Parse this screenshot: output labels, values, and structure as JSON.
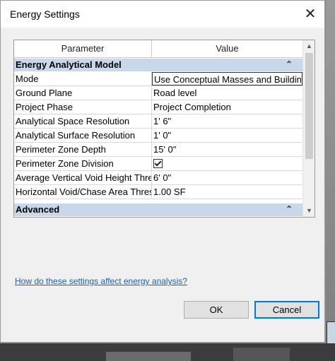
{
  "dialog": {
    "title": "Energy Settings",
    "close_glyph": "✕"
  },
  "grid": {
    "headers": {
      "parameter": "Parameter",
      "value": "Value"
    },
    "categories": [
      {
        "label": "Energy Analytical Model",
        "chevron": "⌃"
      },
      {
        "label": "Advanced",
        "chevron": "⌃"
      }
    ],
    "rows": [
      {
        "param": "Mode",
        "value": "Use Conceptual Masses and Buildin"
      },
      {
        "param": "Ground Plane",
        "value": "Road level"
      },
      {
        "param": "Project Phase",
        "value": "Project Completion"
      },
      {
        "param": "Analytical Space Resolution",
        "value": "1'  6\""
      },
      {
        "param": "Analytical Surface Resolution",
        "value": "1'  0\""
      },
      {
        "param": "Perimeter Zone Depth",
        "value": "15'  0\""
      },
      {
        "param": "Perimeter Zone Division",
        "value": "",
        "checked": true
      },
      {
        "param": "Average Vertical Void Height Thres",
        "value": "6'  0\""
      },
      {
        "param": "Horizontal Void/Chase Area Thresh",
        "value": "1.00 SF"
      }
    ],
    "scroll_up": "▲",
    "scroll_down": "▼"
  },
  "help_link": "How do these settings affect energy analysis?",
  "buttons": {
    "ok": "OK",
    "cancel": "Cancel"
  }
}
